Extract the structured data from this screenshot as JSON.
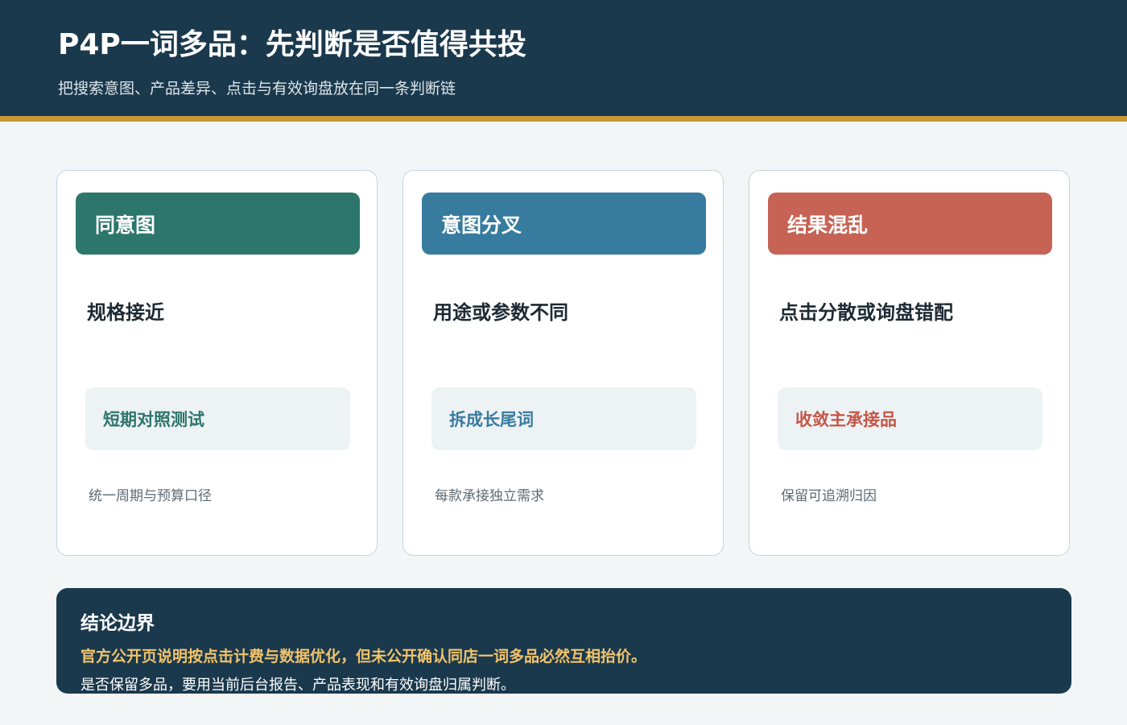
{
  "header": {
    "title": "P4P一词多品：先判断是否值得共投",
    "subtitle": "把搜索意图、产品差异、点击与有效询盘放在同一条判断链"
  },
  "cards": [
    {
      "heading": "同意图",
      "description": "规格接近",
      "action": "短期对照测试",
      "note": "统一周期与预算口径",
      "color": "#2d766c"
    },
    {
      "heading": "意图分叉",
      "description": "用途或参数不同",
      "action": "拆成长尾词",
      "note": "每款承接独立需求",
      "color": "#377b9e"
    },
    {
      "heading": "结果混乱",
      "description": "点击分散或询盘错配",
      "action": "收敛主承接品",
      "note": "保留可追溯归因",
      "color": "#c66354"
    }
  ],
  "conclusion": {
    "title": "结论边界",
    "highlight": "官方公开页说明按点击计费与数据优化，但未公开确认同店一词多品必然互相抬价。",
    "body": "是否保留多品，要用当前后台报告、产品表现和有效询盘归属判断。"
  },
  "colors": {
    "header_bg": "#1b394d",
    "accent_rule": "#c9973a",
    "highlight_text": "#f1c36b"
  }
}
